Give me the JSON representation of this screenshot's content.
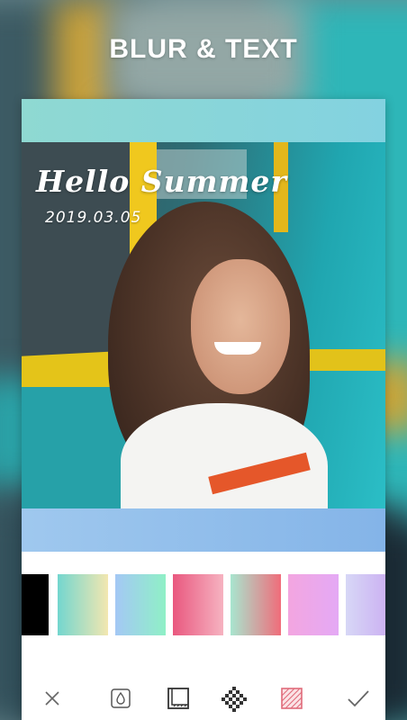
{
  "header": {
    "title": "BLUR & TEXT"
  },
  "photo": {
    "title": "Hello Summer",
    "date": "2019.03.05"
  },
  "colors": {
    "band_top": "#8fd9d2",
    "band_bottom": "#84b4e8"
  },
  "gradients": [
    {
      "name": "black",
      "colors": [
        "#000000",
        "#000000"
      ]
    },
    {
      "name": "mint-lemon",
      "colors": [
        "#73d6cf",
        "#f3e7b0"
      ]
    },
    {
      "name": "blue-mint",
      "colors": [
        "#a4c8f5",
        "#8ff0c6"
      ]
    },
    {
      "name": "rose",
      "colors": [
        "#e9587f",
        "#f6b3c1"
      ]
    },
    {
      "name": "mint-coral",
      "colors": [
        "#a8e6cf",
        "#f06c7a"
      ]
    },
    {
      "name": "pink-lilac",
      "colors": [
        "#f3a6e0",
        "#e4a9f5"
      ]
    },
    {
      "name": "lavender",
      "colors": [
        "#d7d7f6",
        "#c9a9f1"
      ]
    }
  ],
  "toolbar": [
    {
      "name": "close-icon"
    },
    {
      "name": "blur-drop-icon"
    },
    {
      "name": "frame-icon"
    },
    {
      "name": "mosaic-icon"
    },
    {
      "name": "pattern-icon"
    },
    {
      "name": "confirm-check-icon"
    }
  ]
}
